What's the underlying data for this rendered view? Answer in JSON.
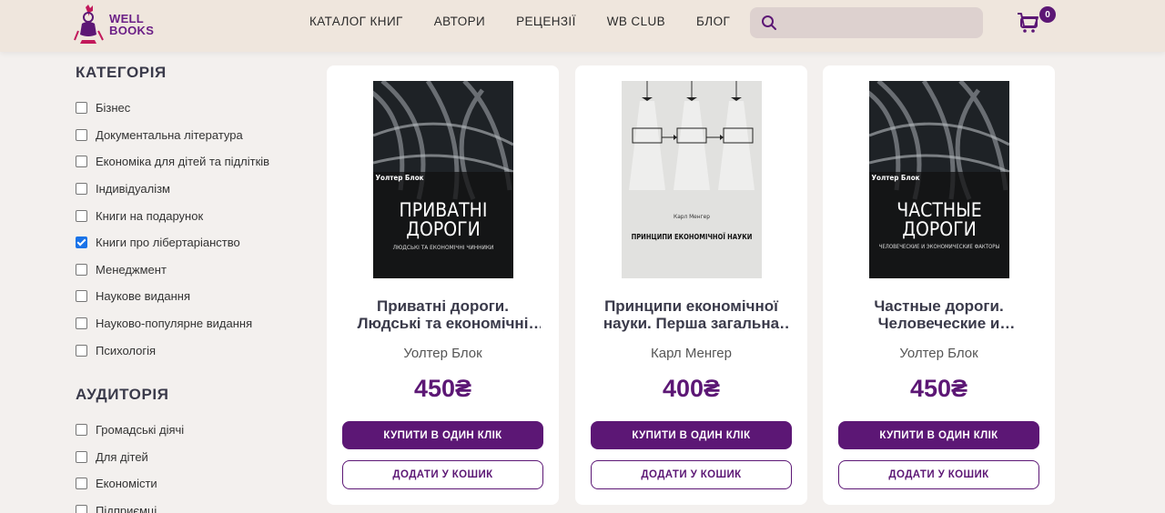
{
  "header": {
    "logo_line1": "WELL",
    "logo_line2": "BOOKS",
    "nav": [
      "КАТАЛОГ КНИГ",
      "АВТОРИ",
      "РЕЦЕНЗІЇ",
      "WB CLUB",
      "БЛОГ"
    ],
    "search_placeholder": "",
    "cart_count": "0"
  },
  "sidebar": {
    "categories_title": "КАТЕГОРІЯ",
    "categories": [
      {
        "label": "Бізнес",
        "checked": false
      },
      {
        "label": "Документальна література",
        "checked": false
      },
      {
        "label": "Економіка для дітей та підлітків",
        "checked": false
      },
      {
        "label": "Індивідуалізм",
        "checked": false
      },
      {
        "label": "Книги на подарунок",
        "checked": false
      },
      {
        "label": "Книги про лібертаріанство",
        "checked": true
      },
      {
        "label": "Менеджмент",
        "checked": false
      },
      {
        "label": "Наукове видання",
        "checked": false
      },
      {
        "label": "Науково-популярне видання",
        "checked": false
      },
      {
        "label": "Психологія",
        "checked": false
      }
    ],
    "audience_title": "АУДИТОРІЯ",
    "audience": [
      {
        "label": "Громадські діячі",
        "checked": false
      },
      {
        "label": "Для дітей",
        "checked": false
      },
      {
        "label": "Економісти",
        "checked": false
      },
      {
        "label": "Підприємці",
        "checked": false
      }
    ]
  },
  "products": [
    {
      "title": "Приватні дороги. Людські та економічні чинники",
      "author": "Уолтер Блок",
      "price": "450₴",
      "buy_label": "КУПИТИ В ОДИН КЛІК",
      "cart_label": "ДОДАТИ У КОШИК",
      "cover": {
        "author": "Уолтер Блок",
        "title_line1": "ПРИВАТНІ",
        "title_line2": "ДОРОГИ",
        "subtitle": "ЛЮДСЬКІ ТА ЕКОНОМІЧНІ ЧИННИКИ"
      }
    },
    {
      "title": "Принципи економічної науки. Перша загальна частина",
      "author": "Карл Менгер",
      "price": "400₴",
      "buy_label": "КУПИТИ В ОДИН КЛІК",
      "cart_label": "ДОДАТИ У КОШИК",
      "cover": {
        "author": "Карл Менгер",
        "title": "ПРИНЦИПИ ЕКОНОМІЧНОЇ НАУКИ"
      }
    },
    {
      "title": "Частные дороги. Человеческие и экономические факторы",
      "author": "Уолтер Блок",
      "price": "450₴",
      "buy_label": "КУПИТИ В ОДИН КЛІК",
      "cart_label": "ДОДАТИ У КОШИК",
      "cover": {
        "author": "Уолтер Блок",
        "title_line1": "ЧАСТНЫЕ",
        "title_line2": "ДОРОГИ",
        "subtitle": "ЧЕЛОВЕЧЕСКИЕ И ЭКОНОМИЧЕСКИЕ ФАКТОРЫ"
      }
    }
  ],
  "colors": {
    "brand": "#5c1775",
    "header_bg": "#efe6dd",
    "page_bg": "#f3f0ee",
    "checkbox_checked": "#1a73e8"
  }
}
